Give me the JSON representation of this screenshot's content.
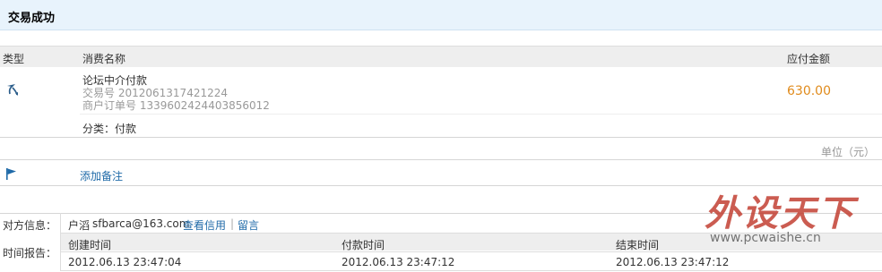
{
  "header": {
    "title": "交易成功"
  },
  "table": {
    "col_type": "类型",
    "col_name": "消费名称",
    "col_amount": "应付金额"
  },
  "order": {
    "name": "论坛中介付款",
    "trade_no_label": "交易号",
    "trade_no": "2012061317421224",
    "merchant_no_label": "商户订单号",
    "merchant_no": "1339602424403856012",
    "amount": "630.00",
    "category_label": "分类：",
    "category": "付款",
    "icon": "transfer-icon"
  },
  "unit": "单位（元）",
  "note": {
    "label": "添加备注",
    "icon": "flag-icon"
  },
  "counterparty": {
    "label": "对方信息：",
    "name": "户滔",
    "email": "sfbarca@163.com",
    "credit_link": "查看信用",
    "separator": "|",
    "message_link": "留言"
  },
  "time_report": {
    "label": "时间报告：",
    "created_label": "创建时间",
    "paid_label": "付款时间",
    "finished_label": "结束时间",
    "created": "2012.06.13 23:47:04",
    "paid": "2012.06.13 23:47:12",
    "finished": "2012.06.13 23:47:12"
  },
  "watermark": {
    "logo": "外设天下",
    "url": "www.pcwaishe.cn"
  },
  "colors": {
    "accent_amount": "#e08b1c",
    "link": "#1f6aa8",
    "header_bg": "#e8f3fc"
  }
}
